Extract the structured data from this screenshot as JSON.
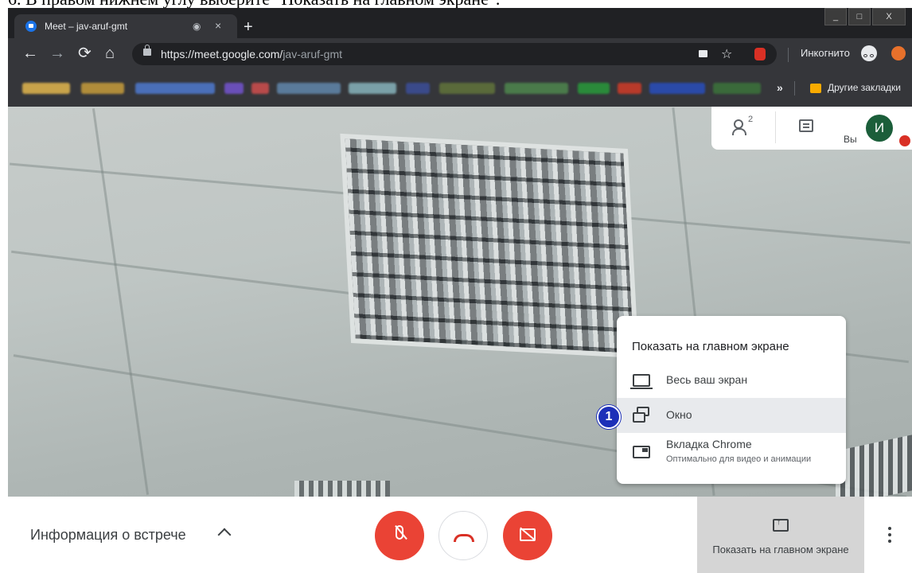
{
  "caption": "6. В правом нижнем углу выберите \"Показать на главном экране\".",
  "window_controls": {
    "minimize": "_",
    "maximize": "□",
    "close": "X"
  },
  "tab": {
    "title": "Meet – jav-aruf-gmt",
    "close": "×",
    "new_tab": "+"
  },
  "toolbar": {
    "url_host": "https://meet.google.com/",
    "url_path": "jav-aruf-gmt",
    "incognito_label": "Инкогнито"
  },
  "bookmarks": {
    "more": "»",
    "other_label": "Другие закладки"
  },
  "meet_header": {
    "participants_count": "2",
    "you_label": "Вы",
    "avatar_letter": "И"
  },
  "present_menu": {
    "title": "Показать на главном экране",
    "items": [
      {
        "label": "Весь ваш экран",
        "icon": "screen-icon"
      },
      {
        "label": "Окно",
        "icon": "window-icon",
        "highlighted": true
      },
      {
        "label": "Вкладка Chrome",
        "sublabel": "Оптимально для видео и анимации",
        "icon": "chrome-tab-icon"
      }
    ]
  },
  "step_badge": "1",
  "bottom_bar": {
    "meeting_info": "Информация о встрече",
    "present_label": "Показать на главном экране"
  },
  "colors": {
    "red": "#ea4335",
    "avatar": "#1b5e3a",
    "badge": "#1c2fb8",
    "browser_dark": "#202124"
  }
}
